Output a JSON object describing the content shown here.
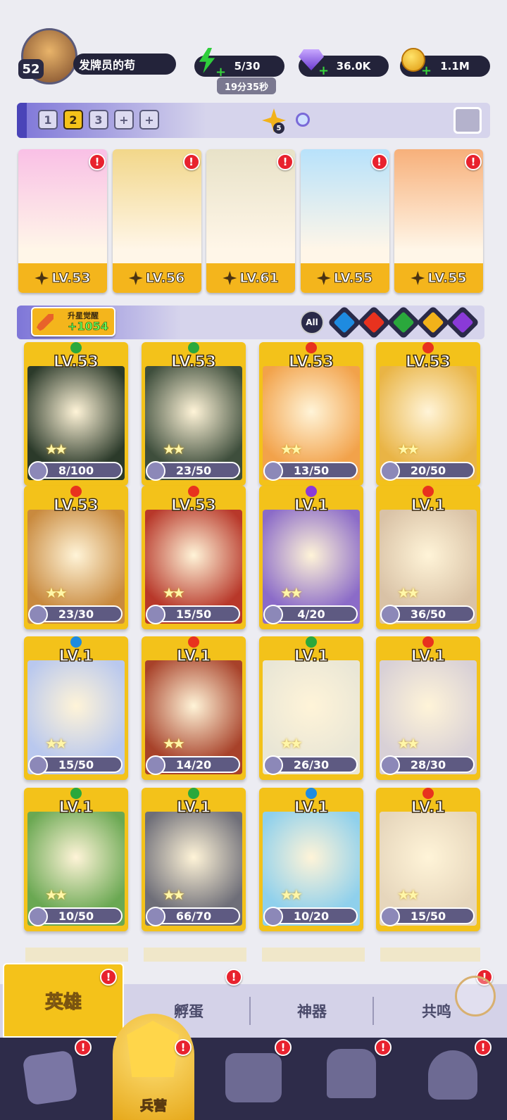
{
  "player": {
    "level": "52",
    "name": "发牌员的苟"
  },
  "resources": {
    "energy": "5/30",
    "energy_timer": "19分35秒",
    "gems": "36.0K",
    "gold": "1.1M"
  },
  "team_tabs": [
    "1",
    "2",
    "3",
    "+",
    "+"
  ],
  "team_tab_selected": "2",
  "team_power_badge": "5",
  "team": [
    {
      "level": "LV.53",
      "color": "#f9c0e6"
    },
    {
      "level": "LV.56",
      "color": "#f2d78a"
    },
    {
      "level": "LV.61",
      "color": "#e8e2c8"
    },
    {
      "level": "LV.55",
      "color": "#b8e2fb"
    },
    {
      "level": "LV.55",
      "color": "#f7b07a"
    }
  ],
  "awaken": {
    "label": "升星觉醒",
    "value": "+1054"
  },
  "filters": {
    "all_label": "All",
    "elements": [
      "water",
      "fire",
      "nature",
      "light",
      "dark"
    ]
  },
  "element_colors": {
    "water": "#1e8be0",
    "fire": "#e8321e",
    "nature": "#2aa83c",
    "light": "#f2b21a",
    "dark": "#8a3ad8"
  },
  "heroes": [
    {
      "level": "LV.53",
      "element": "nature",
      "progress": "8/100",
      "art": "#2b3a2a"
    },
    {
      "level": "LV.53",
      "element": "nature",
      "progress": "23/50",
      "art": "#3e4e3c"
    },
    {
      "level": "LV.53",
      "element": "fire",
      "progress": "13/50",
      "art": "#f2a24a"
    },
    {
      "level": "LV.53",
      "element": "fire",
      "progress": "20/50",
      "art": "#e9b445"
    },
    {
      "level": "LV.53",
      "element": "fire",
      "progress": "23/30",
      "art": "#c98a3e"
    },
    {
      "level": "LV.53",
      "element": "fire",
      "progress": "15/50",
      "art": "#b8382a"
    },
    {
      "level": "LV.1",
      "element": "dark",
      "progress": "4/20",
      "art": "#8b6bc8"
    },
    {
      "level": "LV.1",
      "element": "fire",
      "progress": "36/50",
      "art": "#d9c2a6"
    },
    {
      "level": "LV.1",
      "element": "water",
      "progress": "15/50",
      "art": "#b9c8ee"
    },
    {
      "level": "LV.1",
      "element": "fire",
      "progress": "14/20",
      "art": "#a8422a"
    },
    {
      "level": "LV.1",
      "element": "nature",
      "progress": "26/30",
      "art": "#e9e6d6"
    },
    {
      "level": "LV.1",
      "element": "fire",
      "progress": "28/30",
      "art": "#d8d0d6"
    },
    {
      "level": "LV.1",
      "element": "nature",
      "progress": "10/50",
      "art": "#6aa852"
    },
    {
      "level": "LV.1",
      "element": "nature",
      "progress": "66/70",
      "art": "#6e6e78"
    },
    {
      "level": "LV.1",
      "element": "water",
      "progress": "10/20",
      "art": "#8fd0ec"
    },
    {
      "level": "LV.1",
      "element": "fire",
      "progress": "15/50",
      "art": "#e6d6bc"
    }
  ],
  "sub_tabs": [
    "英雄",
    "孵蛋",
    "神器",
    "共鸣"
  ],
  "nav": {
    "center_label": "兵营"
  }
}
